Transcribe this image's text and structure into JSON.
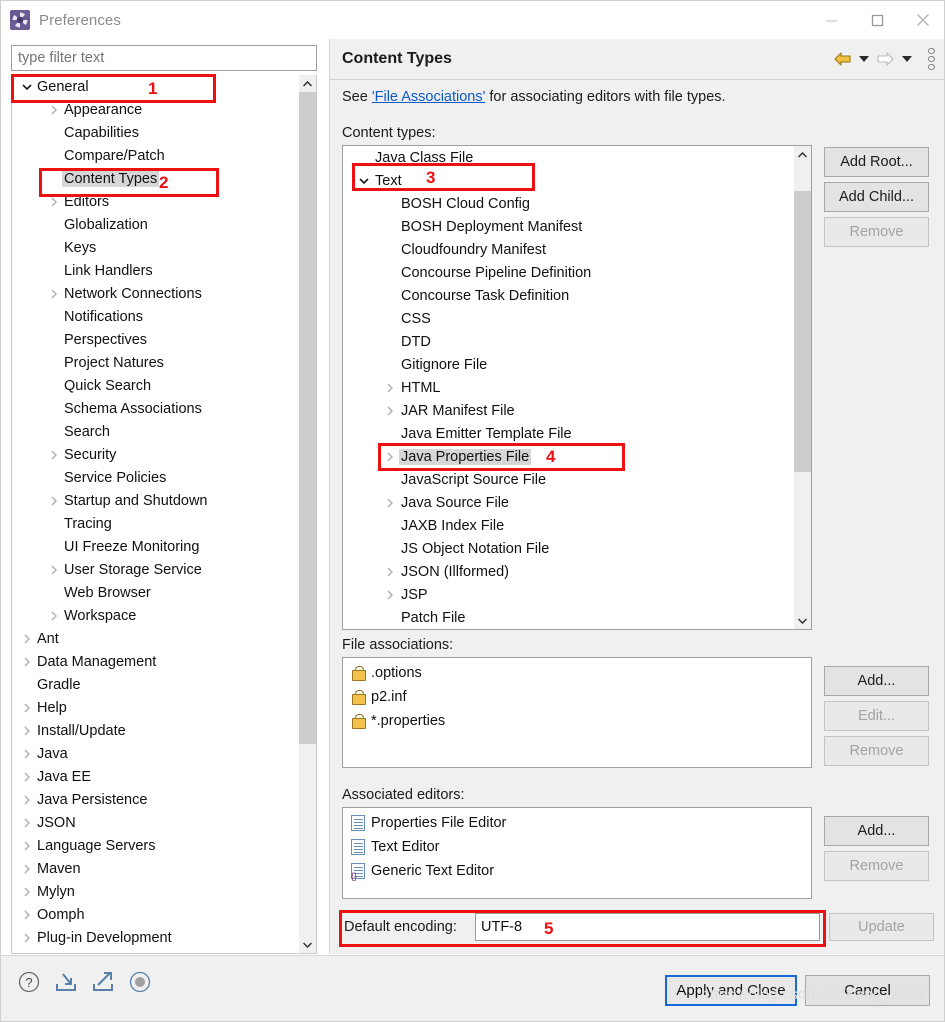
{
  "window": {
    "title": "Preferences",
    "icon": "gear-icon",
    "minimize": "minimize-icon",
    "maximize": "maximize-icon",
    "close": "close-icon"
  },
  "filter": {
    "placeholder": "type filter text",
    "value": ""
  },
  "sidebar": {
    "items": [
      {
        "label": "General",
        "level": 1,
        "twisty": "down",
        "selected": false
      },
      {
        "label": "Appearance",
        "level": 2,
        "twisty": "right",
        "selected": false
      },
      {
        "label": "Capabilities",
        "level": 2,
        "twisty": "none",
        "selected": false
      },
      {
        "label": "Compare/Patch",
        "level": 2,
        "twisty": "none",
        "selected": false
      },
      {
        "label": "Content Types",
        "level": 2,
        "twisty": "none",
        "selected": true
      },
      {
        "label": "Editors",
        "level": 2,
        "twisty": "right",
        "selected": false
      },
      {
        "label": "Globalization",
        "level": 2,
        "twisty": "none",
        "selected": false
      },
      {
        "label": "Keys",
        "level": 2,
        "twisty": "none",
        "selected": false
      },
      {
        "label": "Link Handlers",
        "level": 2,
        "twisty": "none",
        "selected": false
      },
      {
        "label": "Network Connections",
        "level": 2,
        "twisty": "right",
        "selected": false
      },
      {
        "label": "Notifications",
        "level": 2,
        "twisty": "none",
        "selected": false
      },
      {
        "label": "Perspectives",
        "level": 2,
        "twisty": "none",
        "selected": false
      },
      {
        "label": "Project Natures",
        "level": 2,
        "twisty": "none",
        "selected": false
      },
      {
        "label": "Quick Search",
        "level": 2,
        "twisty": "none",
        "selected": false
      },
      {
        "label": "Schema Associations",
        "level": 2,
        "twisty": "none",
        "selected": false
      },
      {
        "label": "Search",
        "level": 2,
        "twisty": "none",
        "selected": false
      },
      {
        "label": "Security",
        "level": 2,
        "twisty": "right",
        "selected": false
      },
      {
        "label": "Service Policies",
        "level": 2,
        "twisty": "none",
        "selected": false
      },
      {
        "label": "Startup and Shutdown",
        "level": 2,
        "twisty": "right",
        "selected": false
      },
      {
        "label": "Tracing",
        "level": 2,
        "twisty": "none",
        "selected": false
      },
      {
        "label": "UI Freeze Monitoring",
        "level": 2,
        "twisty": "none",
        "selected": false
      },
      {
        "label": "User Storage Service",
        "level": 2,
        "twisty": "right",
        "selected": false
      },
      {
        "label": "Web Browser",
        "level": 2,
        "twisty": "none",
        "selected": false
      },
      {
        "label": "Workspace",
        "level": 2,
        "twisty": "right",
        "selected": false
      },
      {
        "label": "Ant",
        "level": 1,
        "twisty": "right",
        "selected": false
      },
      {
        "label": "Data Management",
        "level": 1,
        "twisty": "right",
        "selected": false
      },
      {
        "label": "Gradle",
        "level": 1,
        "twisty": "none",
        "selected": false
      },
      {
        "label": "Help",
        "level": 1,
        "twisty": "right",
        "selected": false
      },
      {
        "label": "Install/Update",
        "level": 1,
        "twisty": "right",
        "selected": false
      },
      {
        "label": "Java",
        "level": 1,
        "twisty": "right",
        "selected": false
      },
      {
        "label": "Java EE",
        "level": 1,
        "twisty": "right",
        "selected": false
      },
      {
        "label": "Java Persistence",
        "level": 1,
        "twisty": "right",
        "selected": false
      },
      {
        "label": "JSON",
        "level": 1,
        "twisty": "right",
        "selected": false
      },
      {
        "label": "Language Servers",
        "level": 1,
        "twisty": "right",
        "selected": false
      },
      {
        "label": "Maven",
        "level": 1,
        "twisty": "right",
        "selected": false
      },
      {
        "label": "Mylyn",
        "level": 1,
        "twisty": "right",
        "selected": false
      },
      {
        "label": "Oomph",
        "level": 1,
        "twisty": "right",
        "selected": false
      },
      {
        "label": "Plug-in Development",
        "level": 1,
        "twisty": "right",
        "selected": false
      }
    ]
  },
  "page": {
    "title": "Content Types",
    "nav": {
      "back": "back-arrow-icon",
      "back_menu": "back-dropdown-icon",
      "forward": "forward-arrow-icon",
      "forward_menu": "forward-dropdown-icon",
      "menu": "view-menu-icon"
    },
    "description_prefix": "See ",
    "description_link": "'File Associations'",
    "description_suffix": " for associating editors with file types.",
    "content_types_label": "Content types:",
    "file_associations_label": "File associations:",
    "associated_editors_label": "Associated editors:",
    "default_encoding_label": "Default encoding:",
    "default_encoding_value": "UTF-8"
  },
  "content_types": [
    {
      "label": "Java Class File",
      "depth": 1,
      "twisty": "none",
      "selected": false
    },
    {
      "label": "Text",
      "depth": 0,
      "twisty": "down",
      "selected": false
    },
    {
      "label": "BOSH Cloud Config",
      "depth": 2,
      "twisty": "none",
      "selected": false
    },
    {
      "label": "BOSH Deployment Manifest",
      "depth": 2,
      "twisty": "none",
      "selected": false
    },
    {
      "label": "Cloudfoundry Manifest",
      "depth": 2,
      "twisty": "none",
      "selected": false
    },
    {
      "label": "Concourse Pipeline Definition",
      "depth": 2,
      "twisty": "none",
      "selected": false
    },
    {
      "label": "Concourse Task Definition",
      "depth": 2,
      "twisty": "none",
      "selected": false
    },
    {
      "label": "CSS",
      "depth": 2,
      "twisty": "none",
      "selected": false
    },
    {
      "label": "DTD",
      "depth": 2,
      "twisty": "none",
      "selected": false
    },
    {
      "label": "Gitignore File",
      "depth": 2,
      "twisty": "none",
      "selected": false
    },
    {
      "label": "HTML",
      "depth": 2,
      "twisty": "right",
      "selected": false
    },
    {
      "label": "JAR Manifest File",
      "depth": 2,
      "twisty": "right",
      "selected": false
    },
    {
      "label": "Java Emitter Template File",
      "depth": 2,
      "twisty": "none",
      "selected": false
    },
    {
      "label": "Java Properties File",
      "depth": 2,
      "twisty": "right",
      "selected": true
    },
    {
      "label": "JavaScript Source File",
      "depth": 2,
      "twisty": "none",
      "selected": false
    },
    {
      "label": "Java Source File",
      "depth": 2,
      "twisty": "right",
      "selected": false
    },
    {
      "label": "JAXB Index File",
      "depth": 2,
      "twisty": "none",
      "selected": false
    },
    {
      "label": "JS Object Notation File",
      "depth": 2,
      "twisty": "none",
      "selected": false
    },
    {
      "label": "JSON (Illformed)",
      "depth": 2,
      "twisty": "right",
      "selected": false
    },
    {
      "label": "JSP",
      "depth": 2,
      "twisty": "right",
      "selected": false
    },
    {
      "label": "Patch File",
      "depth": 2,
      "twisty": "none",
      "selected": false
    }
  ],
  "content_type_buttons": [
    {
      "label": "Add Root...",
      "enabled": true
    },
    {
      "label": "Add Child...",
      "enabled": true
    },
    {
      "label": "Remove",
      "enabled": false
    }
  ],
  "file_associations": [
    {
      "label": ".options",
      "icon": "lock-icon"
    },
    {
      "label": "p2.inf",
      "icon": "lock-icon"
    },
    {
      "label": "*.properties",
      "icon": "lock-icon"
    }
  ],
  "file_association_buttons": [
    {
      "label": "Add...",
      "enabled": true
    },
    {
      "label": "Edit...",
      "enabled": false
    },
    {
      "label": "Remove",
      "enabled": false
    }
  ],
  "associated_editors": [
    {
      "label": "Properties File Editor",
      "icon": "document-icon"
    },
    {
      "label": "Text Editor",
      "icon": "document-icon"
    },
    {
      "label": "Generic Text Editor",
      "icon": "generic-document-icon"
    }
  ],
  "associated_editor_buttons": [
    {
      "label": "Add...",
      "enabled": true
    },
    {
      "label": "Remove",
      "enabled": false
    }
  ],
  "update_button": {
    "label": "Update",
    "enabled": false
  },
  "footer": {
    "icons": [
      {
        "name": "help-icon"
      },
      {
        "name": "import-icon"
      },
      {
        "name": "export-icon"
      },
      {
        "name": "record-icon"
      }
    ],
    "apply_and_close": "Apply and Close",
    "cancel": "Cancel"
  },
  "watermark": "https://blog.csdn.net/Fang_2001",
  "annotations": [
    {
      "number": "1",
      "target": "sidebar-item-general"
    },
    {
      "number": "2",
      "target": "sidebar-item-content-types"
    },
    {
      "number": "3",
      "target": "content-type-text"
    },
    {
      "number": "4",
      "target": "content-type-java-properties-file"
    },
    {
      "number": "5",
      "target": "default-encoding-field"
    }
  ],
  "colors": {
    "annotation": "#ee1111",
    "link": "#0b58c8",
    "selection": "#d6d6d6",
    "default_button_border": "#1669d6",
    "panel_bg": "#f0f0f0",
    "back_arrow": "#e9a820"
  }
}
